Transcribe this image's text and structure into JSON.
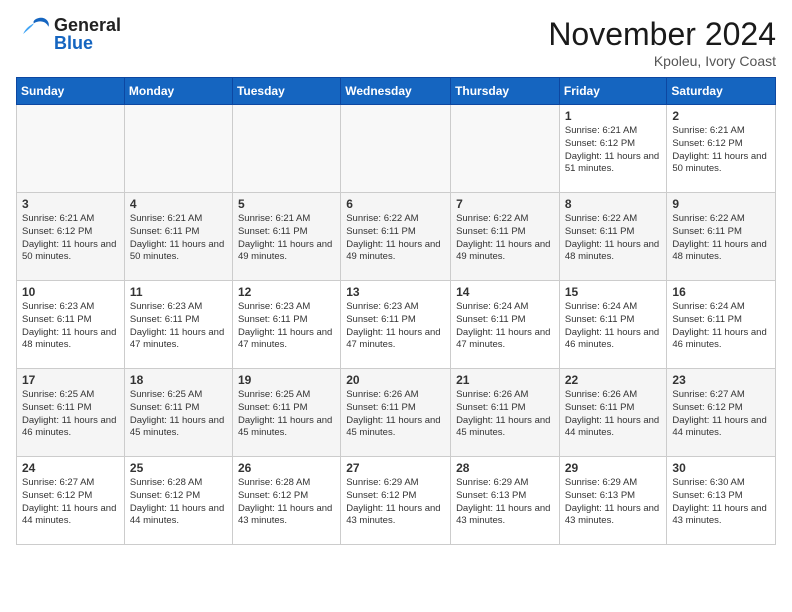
{
  "header": {
    "logo_general": "General",
    "logo_blue": "Blue",
    "month_title": "November 2024",
    "location": "Kpoleu, Ivory Coast"
  },
  "weekdays": [
    "Sunday",
    "Monday",
    "Tuesday",
    "Wednesday",
    "Thursday",
    "Friday",
    "Saturday"
  ],
  "weeks": [
    [
      {
        "day": "",
        "info": ""
      },
      {
        "day": "",
        "info": ""
      },
      {
        "day": "",
        "info": ""
      },
      {
        "day": "",
        "info": ""
      },
      {
        "day": "",
        "info": ""
      },
      {
        "day": "1",
        "info": "Sunrise: 6:21 AM\nSunset: 6:12 PM\nDaylight: 11 hours and 51 minutes."
      },
      {
        "day": "2",
        "info": "Sunrise: 6:21 AM\nSunset: 6:12 PM\nDaylight: 11 hours and 50 minutes."
      }
    ],
    [
      {
        "day": "3",
        "info": "Sunrise: 6:21 AM\nSunset: 6:12 PM\nDaylight: 11 hours and 50 minutes."
      },
      {
        "day": "4",
        "info": "Sunrise: 6:21 AM\nSunset: 6:11 PM\nDaylight: 11 hours and 50 minutes."
      },
      {
        "day": "5",
        "info": "Sunrise: 6:21 AM\nSunset: 6:11 PM\nDaylight: 11 hours and 49 minutes."
      },
      {
        "day": "6",
        "info": "Sunrise: 6:22 AM\nSunset: 6:11 PM\nDaylight: 11 hours and 49 minutes."
      },
      {
        "day": "7",
        "info": "Sunrise: 6:22 AM\nSunset: 6:11 PM\nDaylight: 11 hours and 49 minutes."
      },
      {
        "day": "8",
        "info": "Sunrise: 6:22 AM\nSunset: 6:11 PM\nDaylight: 11 hours and 48 minutes."
      },
      {
        "day": "9",
        "info": "Sunrise: 6:22 AM\nSunset: 6:11 PM\nDaylight: 11 hours and 48 minutes."
      }
    ],
    [
      {
        "day": "10",
        "info": "Sunrise: 6:23 AM\nSunset: 6:11 PM\nDaylight: 11 hours and 48 minutes."
      },
      {
        "day": "11",
        "info": "Sunrise: 6:23 AM\nSunset: 6:11 PM\nDaylight: 11 hours and 47 minutes."
      },
      {
        "day": "12",
        "info": "Sunrise: 6:23 AM\nSunset: 6:11 PM\nDaylight: 11 hours and 47 minutes."
      },
      {
        "day": "13",
        "info": "Sunrise: 6:23 AM\nSunset: 6:11 PM\nDaylight: 11 hours and 47 minutes."
      },
      {
        "day": "14",
        "info": "Sunrise: 6:24 AM\nSunset: 6:11 PM\nDaylight: 11 hours and 47 minutes."
      },
      {
        "day": "15",
        "info": "Sunrise: 6:24 AM\nSunset: 6:11 PM\nDaylight: 11 hours and 46 minutes."
      },
      {
        "day": "16",
        "info": "Sunrise: 6:24 AM\nSunset: 6:11 PM\nDaylight: 11 hours and 46 minutes."
      }
    ],
    [
      {
        "day": "17",
        "info": "Sunrise: 6:25 AM\nSunset: 6:11 PM\nDaylight: 11 hours and 46 minutes."
      },
      {
        "day": "18",
        "info": "Sunrise: 6:25 AM\nSunset: 6:11 PM\nDaylight: 11 hours and 45 minutes."
      },
      {
        "day": "19",
        "info": "Sunrise: 6:25 AM\nSunset: 6:11 PM\nDaylight: 11 hours and 45 minutes."
      },
      {
        "day": "20",
        "info": "Sunrise: 6:26 AM\nSunset: 6:11 PM\nDaylight: 11 hours and 45 minutes."
      },
      {
        "day": "21",
        "info": "Sunrise: 6:26 AM\nSunset: 6:11 PM\nDaylight: 11 hours and 45 minutes."
      },
      {
        "day": "22",
        "info": "Sunrise: 6:26 AM\nSunset: 6:11 PM\nDaylight: 11 hours and 44 minutes."
      },
      {
        "day": "23",
        "info": "Sunrise: 6:27 AM\nSunset: 6:12 PM\nDaylight: 11 hours and 44 minutes."
      }
    ],
    [
      {
        "day": "24",
        "info": "Sunrise: 6:27 AM\nSunset: 6:12 PM\nDaylight: 11 hours and 44 minutes."
      },
      {
        "day": "25",
        "info": "Sunrise: 6:28 AM\nSunset: 6:12 PM\nDaylight: 11 hours and 44 minutes."
      },
      {
        "day": "26",
        "info": "Sunrise: 6:28 AM\nSunset: 6:12 PM\nDaylight: 11 hours and 43 minutes."
      },
      {
        "day": "27",
        "info": "Sunrise: 6:29 AM\nSunset: 6:12 PM\nDaylight: 11 hours and 43 minutes."
      },
      {
        "day": "28",
        "info": "Sunrise: 6:29 AM\nSunset: 6:13 PM\nDaylight: 11 hours and 43 minutes."
      },
      {
        "day": "29",
        "info": "Sunrise: 6:29 AM\nSunset: 6:13 PM\nDaylight: 11 hours and 43 minutes."
      },
      {
        "day": "30",
        "info": "Sunrise: 6:30 AM\nSunset: 6:13 PM\nDaylight: 11 hours and 43 minutes."
      }
    ]
  ]
}
